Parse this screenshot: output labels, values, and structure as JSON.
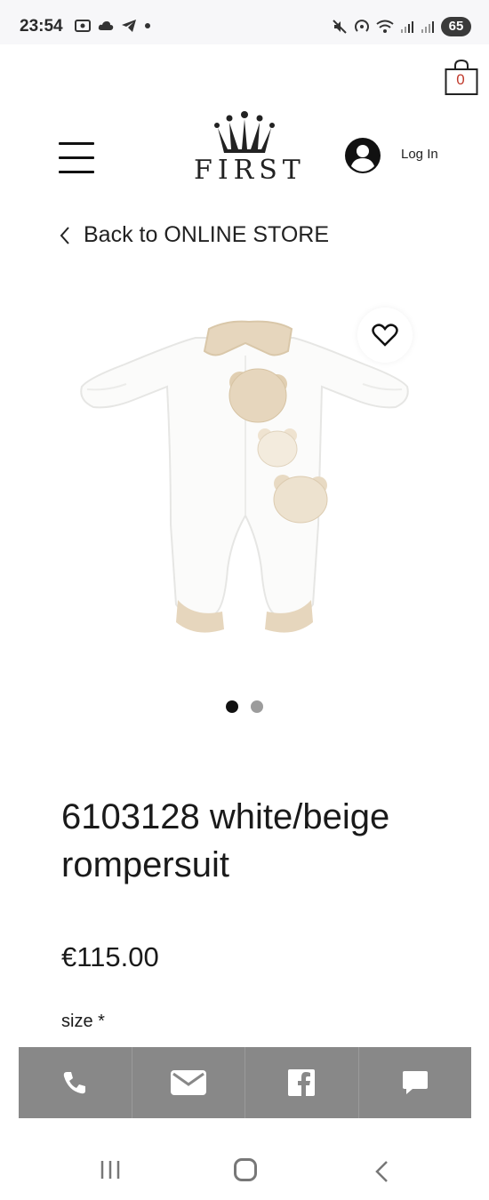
{
  "status_bar": {
    "time": "23:54",
    "battery": "65"
  },
  "header": {
    "cart_count": "0",
    "brand": "FIRST",
    "login_label": "Log In"
  },
  "nav": {
    "back_label": "Back to ONLINE STORE"
  },
  "gallery": {
    "image_count": 2,
    "active_index": 0
  },
  "product": {
    "title": "6103128 white/beige rompersuit",
    "price": "€115.00",
    "size_label": "size *"
  },
  "contact_bar": {
    "items": [
      "phone-icon",
      "mail-icon",
      "facebook-icon",
      "chat-icon"
    ]
  },
  "colors": {
    "accent_cart": "#c0392b",
    "contact_bar_bg": "#888888"
  }
}
